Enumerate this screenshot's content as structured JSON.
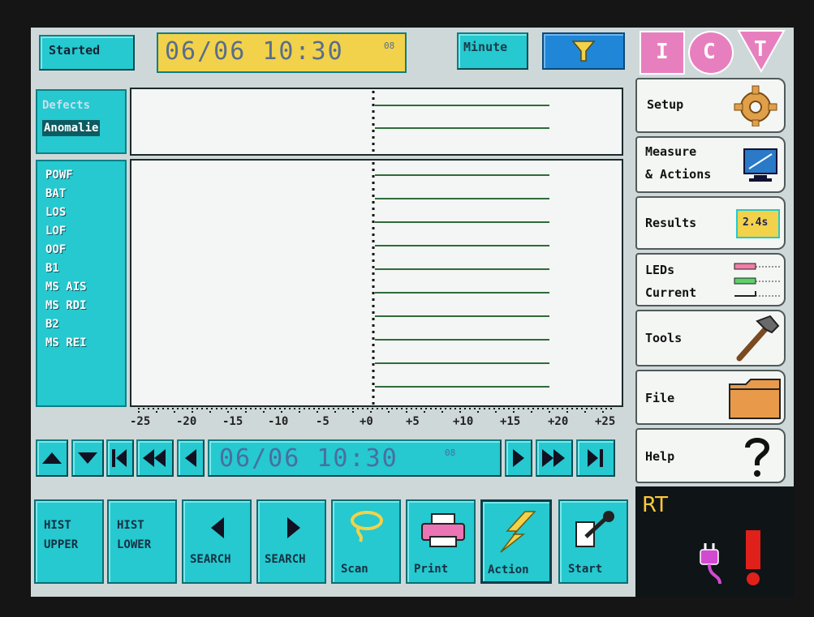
{
  "header": {
    "status": "Started",
    "datetime": "06/06 10:30",
    "seconds": "08",
    "interval": "Minute"
  },
  "logo": [
    "I",
    "C",
    "T"
  ],
  "mode": {
    "defects": "Defects",
    "anomalies": "Anomalie"
  },
  "signals": [
    "POWF",
    "BAT",
    "LOS",
    "LOF",
    "OOF",
    "B1",
    "MS AIS",
    "MS RDI",
    "B2",
    "MS REI"
  ],
  "axis": {
    "ticks": [
      "-25",
      "-20",
      "-15",
      "-10",
      "-5",
      "+0",
      "+5",
      "+10",
      "+15",
      "+20",
      "+25"
    ]
  },
  "nav": {
    "datetime": "06/06 10:30",
    "seconds": "08"
  },
  "menu": {
    "setup": "Setup",
    "measure_line1": "Measure",
    "measure_line2": "& Actions",
    "results": "Results",
    "results_value": "2.4s",
    "leds": "LEDs",
    "current": "Current",
    "tools": "Tools",
    "file": "File",
    "help": "Help"
  },
  "rt": "RT",
  "bottom": {
    "hist_upper_1": "HIST",
    "hist_upper_2": "UPPER",
    "hist_lower_1": "HIST",
    "hist_lower_2": "LOWER",
    "search_back": "SEARCH",
    "search_fwd": "SEARCH",
    "scan": "Scan",
    "print": "Print",
    "action": "Action",
    "start": "Start"
  },
  "colors": {
    "cyan": "#25c9cf",
    "yellow": "#f2d24a",
    "blue": "#1f86d8",
    "trace": "#2f6b3a",
    "rt": "#ffc83a"
  }
}
